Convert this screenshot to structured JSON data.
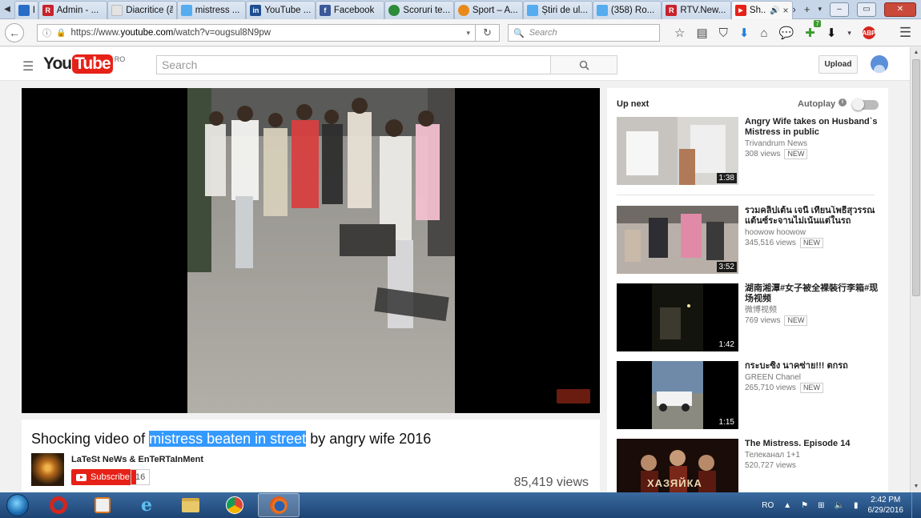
{
  "browser": {
    "tabs": [
      {
        "title": "R...",
        "fav_color": "#2a6dc7",
        "fav_glyph": ""
      },
      {
        "title": "Admin - ...",
        "fav_color": "#c8232c",
        "fav_glyph": "R"
      },
      {
        "title": "Diacritice (ăâî...",
        "fav_color": "#e3e3e3",
        "fav_glyph": ""
      },
      {
        "title": "mistress ...",
        "fav_color": "#55acee",
        "fav_glyph": ""
      },
      {
        "title": "YouTube ...",
        "fav_color": "#1d4f91",
        "fav_glyph": "in"
      },
      {
        "title": "Facebook",
        "fav_color": "#3b5998",
        "fav_glyph": "f"
      },
      {
        "title": "Scoruri te...",
        "fav_color": "#2d8b3a",
        "fav_glyph": ""
      },
      {
        "title": "Sport – A...",
        "fav_color": "#e8891a",
        "fav_glyph": ""
      },
      {
        "title": "Știri de ul...",
        "fav_color": "#55acee",
        "fav_glyph": ""
      },
      {
        "title": "(358) Ro...",
        "fav_color": "#55acee",
        "fav_glyph": ""
      },
      {
        "title": "RTV.New...",
        "fav_color": "#c8232c",
        "fav_glyph": "R"
      },
      {
        "title": "Sh...",
        "fav_color": "#e62117",
        "fav_glyph": "▶"
      }
    ],
    "url_prefix": "https://www.",
    "url_domain": "youtube.com",
    "url_path": "/watch?v=ougsul8N9pw",
    "search_placeholder": "Search",
    "addon_badge": "7",
    "abp_label": "ABP"
  },
  "youtube": {
    "country": "RO",
    "logo_you": "You",
    "logo_tube": "Tube",
    "search_placeholder": "Search",
    "upload_label": "Upload"
  },
  "video": {
    "title_before": "Shocking video of ",
    "title_highlight": "mistress beaten in street",
    "title_after": " by angry wife 2016",
    "channel": "LaTeSt NeWs & EnTeRTaInMent",
    "subscribe_label": "Subscribe",
    "subscriber_count": "16",
    "views": "85,419 views"
  },
  "sidebar": {
    "up_next_label": "Up next",
    "autoplay_label": "Autoplay",
    "items": [
      {
        "title": "Angry Wife takes on Husband`s Mistress in public",
        "channel": "Trivandrum News",
        "views": "308 views",
        "badge": "NEW",
        "duration": "1:38"
      },
      {
        "title": "รวมคลิปเต้น เจนี่ เทียนโพธิ์สุวรรณ แต้นซ์ระจานไม่เน้นแต่ในรถ",
        "channel": "hoowow hoowow",
        "views": "345,516 views",
        "badge": "NEW",
        "duration": "3:52"
      },
      {
        "title": "湖南湘潭#女子被全裸裝行李箱#现场视频",
        "channel": "微博视频",
        "views": "769 views",
        "badge": "NEW",
        "duration": "1:42"
      },
      {
        "title": "กระบะซิ่ง นาคซ่าย!!! ตกรถ",
        "channel": "GREEN Chanel",
        "views": "265,710 views",
        "badge": "NEW",
        "duration": "1:15"
      },
      {
        "title": "The Mistress. Episode 14",
        "channel": "Телеканал 1+1",
        "views": "520,727 views",
        "badge": "",
        "duration": ""
      }
    ],
    "thumb_caption_5": "ХАЗЯЙКА"
  },
  "taskbar": {
    "language": "RO",
    "time": "2:42 PM",
    "date": "6/29/2016"
  },
  "colors": {
    "youtube_red": "#e62117",
    "selection_blue": "#3399ff",
    "taskbar_blue": "#1d4473"
  }
}
